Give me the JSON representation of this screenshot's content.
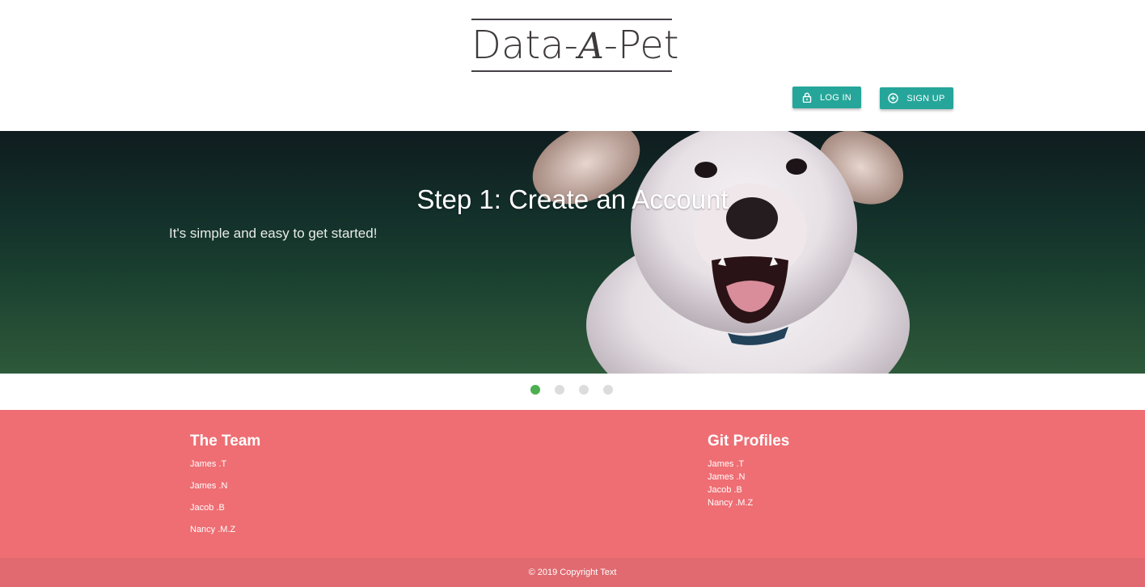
{
  "header": {
    "logo": {
      "left": "Data-",
      "middle": "A",
      "right": "-Pet"
    },
    "login_label": "LOG IN",
    "signup_label": "SIGN UP"
  },
  "hero": {
    "title": "Step 1: Create an Account",
    "subtitle": "It's simple and easy to get started!",
    "slides_total": 4,
    "active_slide": 1
  },
  "footer": {
    "team_title": "The Team",
    "team": [
      "James .T",
      "James .N",
      "Jacob .B",
      "Nancy .M.Z"
    ],
    "git_title": "Git Profiles",
    "git_profiles": [
      "James .T",
      "James .N",
      "Jacob .B",
      "Nancy .M.Z"
    ],
    "copyright": "© 2019 Copyright Text"
  },
  "colors": {
    "accent": "#26a69a",
    "footer": "#ee6e73",
    "footer_bottom": "#e06a70",
    "active_dot": "#4caf50",
    "inactive_dot": "#dcdcdc"
  },
  "icons": {
    "login": "lock-icon",
    "signup": "add-circle-icon"
  }
}
